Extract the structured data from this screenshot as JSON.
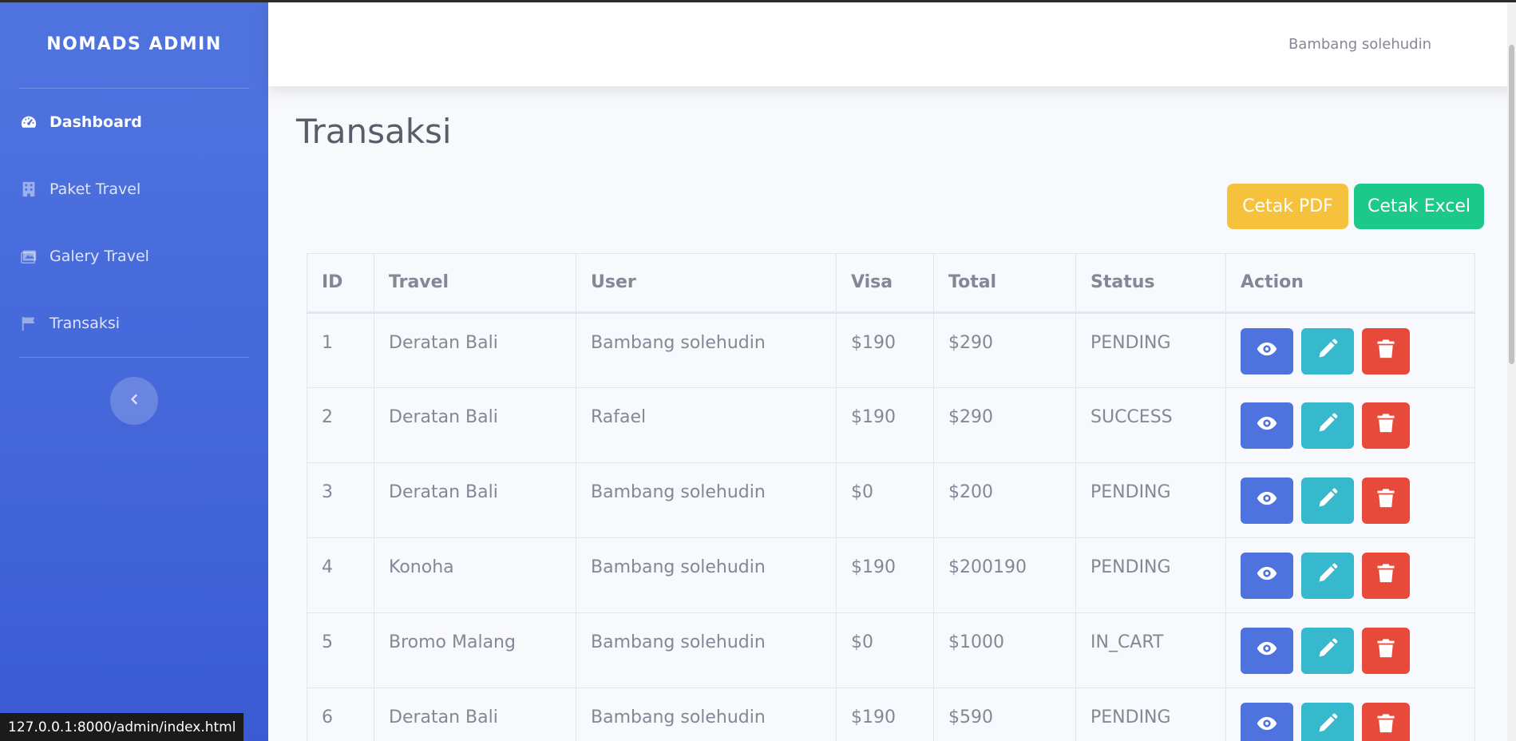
{
  "brand": "NOMADS ADMIN",
  "sidebar": {
    "items": [
      {
        "label": "Dashboard",
        "icon": "dashboard-icon",
        "active": true
      },
      {
        "label": "Paket Travel",
        "icon": "building-icon",
        "active": false
      },
      {
        "label": "Galery Travel",
        "icon": "images-icon",
        "active": false
      },
      {
        "label": "Transaksi",
        "icon": "flag-icon",
        "active": false
      }
    ],
    "toggle_icon": "chevron-left-icon"
  },
  "topbar": {
    "user_name": "Bambang solehudin"
  },
  "page": {
    "title": "Transaksi",
    "buttons": {
      "pdf": "Cetak PDF",
      "excel": "Cetak Excel"
    }
  },
  "table": {
    "headers": [
      "ID",
      "Travel",
      "User",
      "Visa",
      "Total",
      "Status",
      "Action"
    ],
    "rows": [
      {
        "id": "1",
        "travel": "Deratan Bali",
        "user": "Bambang solehudin",
        "visa": "$190",
        "total": "$290",
        "status": "PENDING"
      },
      {
        "id": "2",
        "travel": "Deratan Bali",
        "user": "Rafael",
        "visa": "$190",
        "total": "$290",
        "status": "SUCCESS"
      },
      {
        "id": "3",
        "travel": "Deratan Bali",
        "user": "Bambang solehudin",
        "visa": "$0",
        "total": "$200",
        "status": "PENDING"
      },
      {
        "id": "4",
        "travel": "Konoha",
        "user": "Bambang solehudin",
        "visa": "$190",
        "total": "$200190",
        "status": "PENDING"
      },
      {
        "id": "5",
        "travel": "Bromo Malang",
        "user": "Bambang solehudin",
        "visa": "$0",
        "total": "$1000",
        "status": "IN_CART"
      },
      {
        "id": "6",
        "travel": "Deratan Bali",
        "user": "Bambang solehudin",
        "visa": "$190",
        "total": "$590",
        "status": "PENDING"
      }
    ],
    "action_icons": [
      "eye-icon",
      "pencil-icon",
      "trash-icon"
    ]
  },
  "statusbar": {
    "url": "127.0.0.1:8000/admin/index.html"
  },
  "colors": {
    "primary": "#4e73df",
    "info": "#36b9cc",
    "danger": "#e74a3b",
    "warning": "#f6c23e",
    "success": "#1cc88a"
  }
}
